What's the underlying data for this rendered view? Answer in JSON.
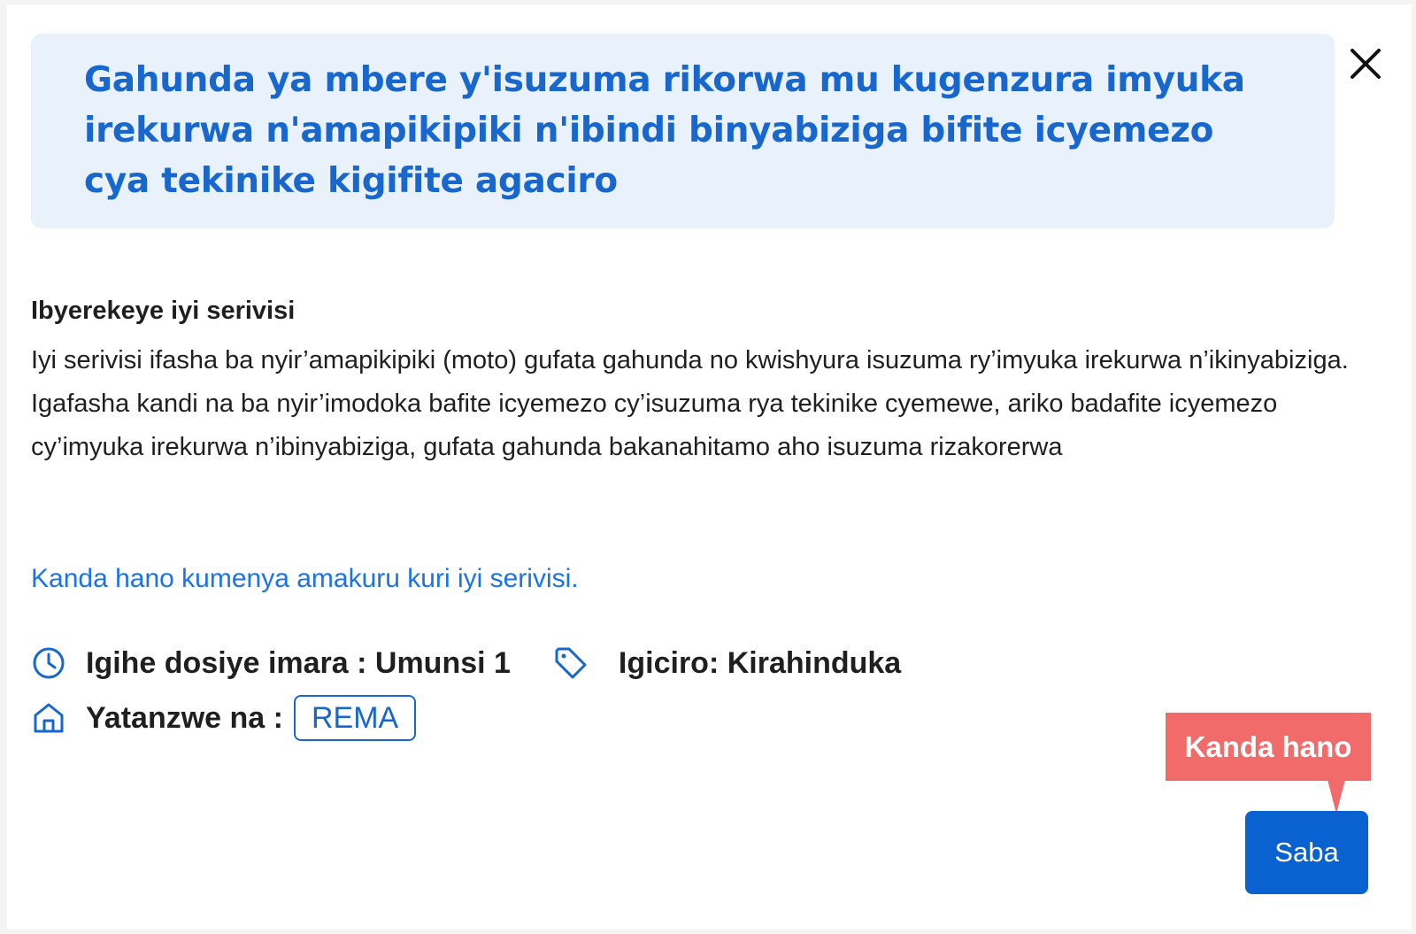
{
  "modal": {
    "title": "Gahunda ya mbere y'isuzuma rikorwa mu kugenzura imyuka irekurwa n'amapikipiki n'ibindi binyabiziga bifite icyemezo cya tekinike kigifite agaciro",
    "close_icon": "close-icon"
  },
  "about": {
    "heading": "Ibyerekeye iyi serivisi",
    "body": "Iyi serivisi ifasha ba nyir’amapikipiki (moto) gufata gahunda no kwishyura isuzuma ry’imyuka irekurwa n’ikinyabiziga. Igafasha kandi na ba nyir’imodoka bafite icyemezo cy’isuzuma rya tekinike cyemewe, ariko badafite icyemezo cy’imyuka irekurwa n’ibinyabiziga, gufata gahunda bakanahitamo aho isuzuma rizakorerwa",
    "link_text": "Kanda hano kumenya amakuru kuri iyi serivisi."
  },
  "meta": {
    "processing_time": "Igihe dosiye imara : Umunsi 1",
    "price": "Igiciro: Kirahinduka",
    "provider_label": "Yatanzwe na :",
    "provider_badge": "REMA",
    "icons": [
      "clock-icon",
      "tag-icon",
      "building-icon"
    ]
  },
  "callout": {
    "text": "Kanda hano"
  },
  "actions": {
    "apply_label": "Saba"
  },
  "colors": {
    "accent": "#1767cf",
    "title_bg": "#e9f1fb",
    "callout": "#f26b6b",
    "button": "#0a62d0",
    "link": "#1a73e8"
  }
}
